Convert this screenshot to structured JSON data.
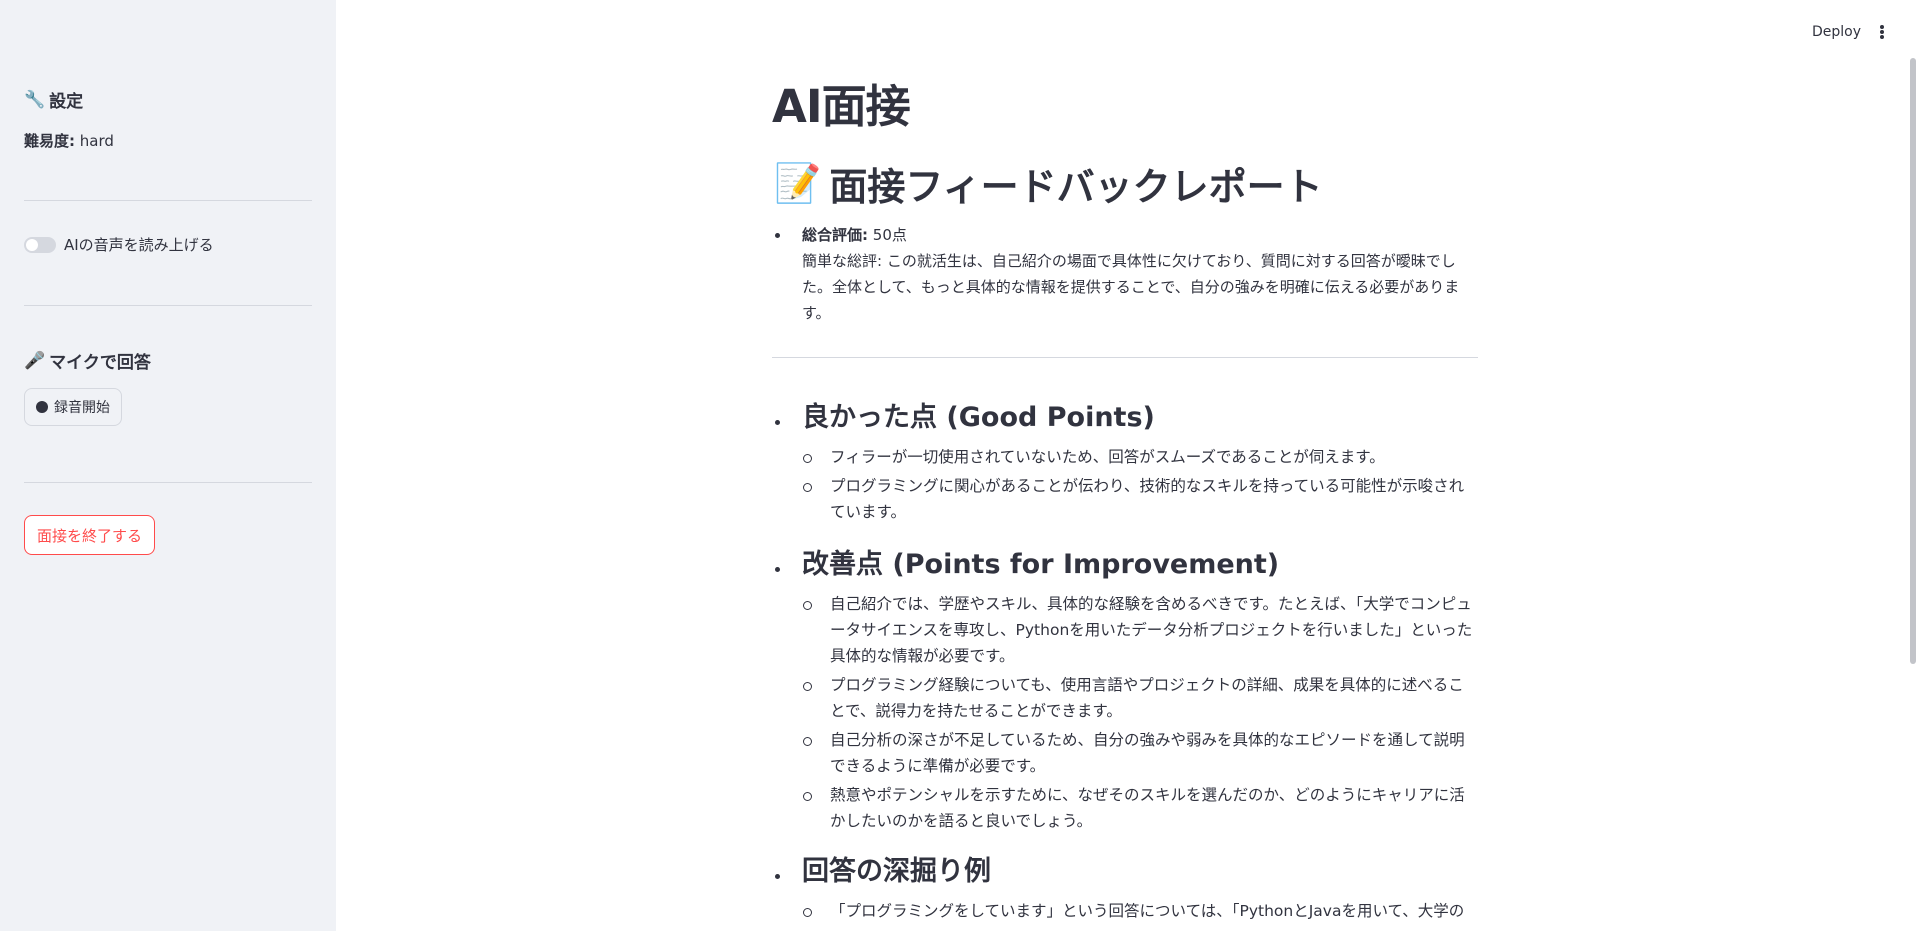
{
  "sidebar": {
    "settings_icon": "wrench-icon",
    "settings_title": "設定",
    "difficulty_label": "難易度:",
    "difficulty_value": "hard",
    "toggle_label": "AIの音声を読み上げる",
    "mic_icon": "microphone-icon",
    "mic_title": "マイクで回答",
    "record_button": "録音開始",
    "end_button": "面接を終了する"
  },
  "header": {
    "deploy_label": "Deploy"
  },
  "main": {
    "app_title": "AI面接",
    "report_icon": "memo-icon",
    "report_title": "面接フィードバックレポート",
    "summary": {
      "score_label": "総合評価:",
      "score_value": "50点",
      "comment": "簡単な総評: この就活生は、自己紹介の場面で具体性に欠けており、質問に対する回答が曖昧でした。全体として、もっと具体的な情報を提供することで、自分の強みを明確に伝える必要があります。"
    },
    "sections": [
      {
        "title": "良かった点 (Good Points)",
        "items": [
          "フィラーが一切使用されていないため、回答がスムーズであることが伺えます。",
          "プログラミングに関心があることが伝わり、技術的なスキルを持っている可能性が示唆されています。"
        ]
      },
      {
        "title": "改善点 (Points for Improvement)",
        "items": [
          "自己紹介では、学歴やスキル、具体的な経験を含めるべきです。たとえば、「大学でコンピュータサイエンスを専攻し、Pythonを用いたデータ分析プロジェクトを行いました」といった具体的な情報が必要です。",
          "プログラミング経験についても、使用言語やプロジェクトの詳細、成果を具体的に述べることで、説得力を持たせることができます。",
          "自己分析の深さが不足しているため、自分の強みや弱みを具体的なエピソードを通して説明できるように準備が必要です。",
          "熱意やポテンシャルを示すために、なぜそのスキルを選んだのか、どのようにキャリアに活かしたいのかを語ると良いでしょう。"
        ]
      },
      {
        "title": "回答の深掘り例",
        "items": [
          "「プログラミングをしています」という回答については、「PythonとJavaを用いて、大学の"
        ]
      }
    ]
  }
}
